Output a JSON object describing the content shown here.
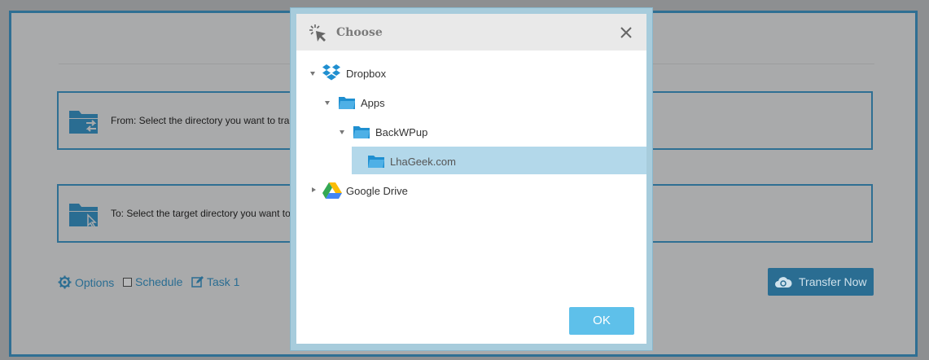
{
  "background_app": {
    "from_text": "From: Select the directory you want to tra",
    "to_text": "To: Select the target directory you want to",
    "options_label": "Options",
    "schedule_label": "Schedule",
    "task_label": "Task 1",
    "transfer_button_label": "Transfer Now"
  },
  "dialog": {
    "title": "Choose",
    "ok_label": "OK",
    "tree": [
      {
        "label": "Dropbox",
        "expanded": true,
        "icon": "dropbox-icon"
      },
      {
        "label": "Apps",
        "expanded": true,
        "icon": "folder-icon"
      },
      {
        "label": "BackWPup",
        "expanded": true,
        "icon": "folder-icon"
      },
      {
        "label": "LhaGeek.com",
        "selected": true,
        "icon": "folder-icon"
      },
      {
        "label": "Google Drive",
        "expanded": false,
        "icon": "google-drive-icon"
      }
    ]
  },
  "colors": {
    "accent": "#2a6d92",
    "ok_button": "#5ec0ea",
    "selected_row": "#b3d8ea",
    "folder": "#1f8fd0"
  }
}
